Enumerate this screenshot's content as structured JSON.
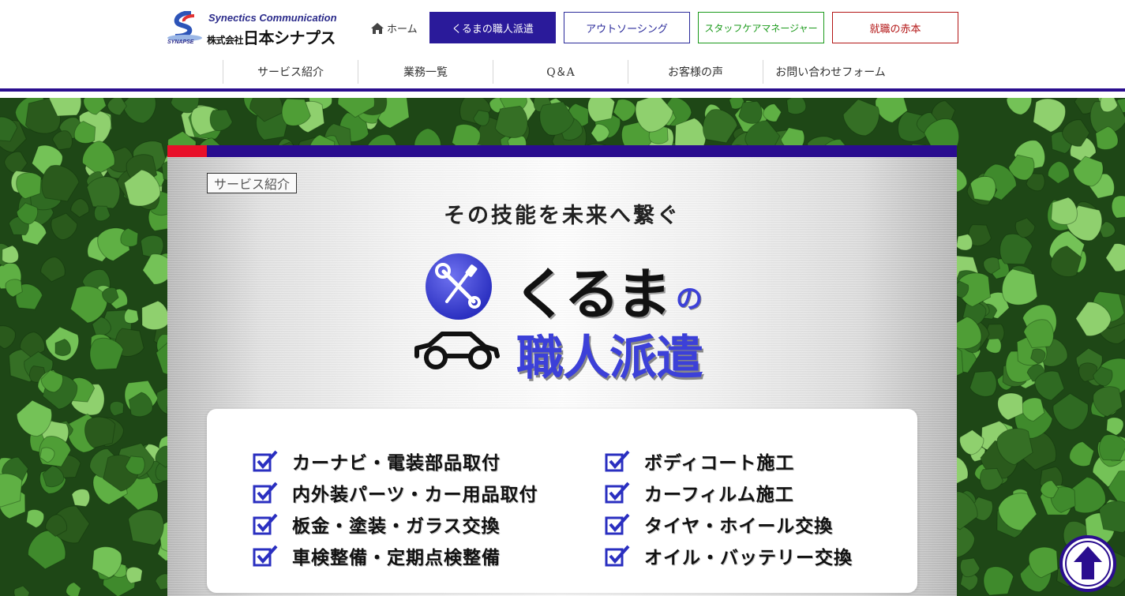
{
  "logo": {
    "en": "Synectics Communication",
    "jp_small": "株式会社",
    "jp_name": "日本シナプス",
    "sub": "SYNAPSE"
  },
  "header": {
    "home_label": "ホーム",
    "buttons": [
      {
        "label": "くるまの職人派遣",
        "color": "#2a1a9a"
      },
      {
        "label": "アウトソーシング",
        "color": "#2a2a9a"
      },
      {
        "label": "スタッフケアマネージャー",
        "color": "#1a9a1a"
      },
      {
        "label": "就職の赤本",
        "color": "#b31515"
      }
    ],
    "nav": [
      "サービス紹介",
      "業務一覧",
      "Q＆A",
      "お客様の声",
      "お問い合わせフォーム"
    ],
    "accent_color": "#2a0d8f"
  },
  "main": {
    "tag": "サービス紹介",
    "tagline": "その技能を未来へ繋ぐ",
    "title_kuruma": "くるま",
    "title_no": "の",
    "title_shokunin": "職人派遣",
    "services_left": [
      "カーナビ・電装部品取付",
      "内外装パーツ・カー用品取付",
      "板金・塗装・ガラス交換",
      "車検整備・定期点検整備"
    ],
    "services_right": [
      "ボディコート施工",
      "カーフィルム施工",
      "タイヤ・ホイール交換",
      "オイル・バッテリー交換"
    ]
  },
  "icons": {
    "home": "home-icon",
    "tools": "wrench-screwdriver-icon",
    "car": "car-icon",
    "check": "checkbox-icon",
    "scroll_top": "arrow-up-icon"
  }
}
